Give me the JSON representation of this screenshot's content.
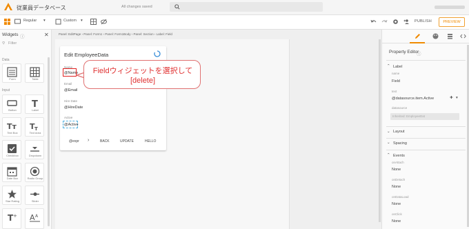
{
  "app": {
    "title": "従業員データベース",
    "save_status": "All changes saved"
  },
  "toolbar": {
    "device": "Regular",
    "size": "Custom",
    "publish": "PUBLISH",
    "preview": "PREVIEW"
  },
  "widgets": {
    "title": "Widgets",
    "filter_placeholder": "Filter",
    "sections": {
      "data": "Data",
      "input": "Input"
    },
    "items": [
      "Form",
      "Table",
      "Button",
      "Label",
      "Text Box",
      "Text Area",
      "Checkbox",
      "Dropdown",
      "Date Box",
      "Radio Group",
      "Star Rating",
      "Slider"
    ]
  },
  "canvas": {
    "breadcrumb": "Panel: EditPage › Panel: Form1 › Panel: Form1Body › Panel: Section › Label: Field",
    "form": {
      "title": "Edit EmployeeData",
      "fields": [
        {
          "label": "Name",
          "value": "@Name"
        },
        {
          "label": "Email",
          "value": "@Email"
        },
        {
          "label": "Hire Date",
          "value": "@HireDate"
        },
        {
          "label": "Active",
          "value": "@Active"
        }
      ],
      "buttons": [
        "@expr",
        "›",
        "BACK",
        "UPDATE",
        "HELLO"
      ]
    },
    "callout": {
      "line1": "Fieldウィジェットを選択して",
      "line2": "[delete]"
    }
  },
  "property_editor": {
    "title": "Property Editor",
    "label_section": "Label",
    "name_label": "name",
    "name_value": "Field",
    "text_label": "text",
    "text_value": "@datasource.item.Active",
    "datasource_label": "datasource",
    "datasource_value": "Inherited: EmployeeDat",
    "sections": [
      "Layout",
      "Spacing",
      "Events"
    ],
    "events": [
      {
        "name": "onAttach",
        "value": "None"
      },
      {
        "name": "onDetach",
        "value": "None"
      },
      {
        "name": "onDataLoad",
        "value": "None"
      },
      {
        "name": "onClick",
        "value": "None"
      }
    ]
  }
}
